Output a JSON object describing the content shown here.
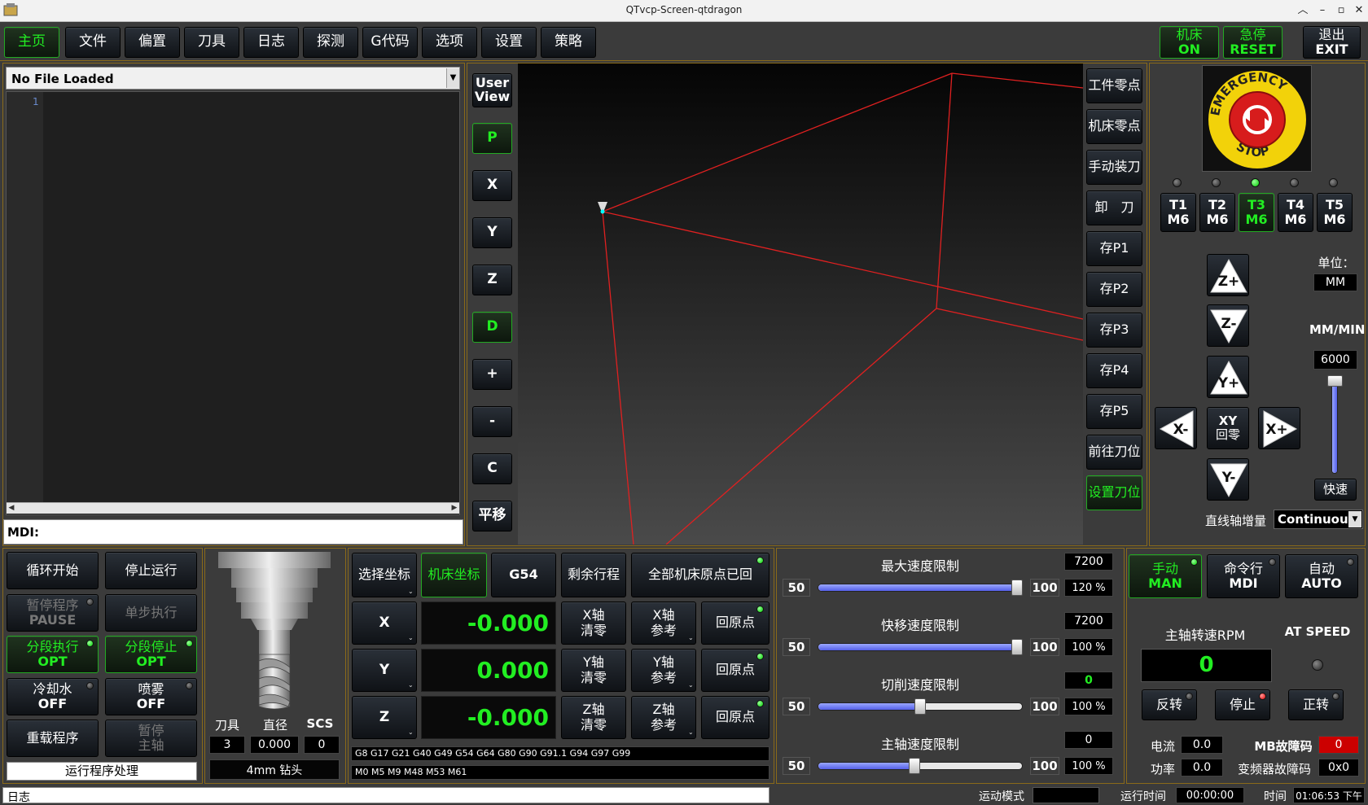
{
  "window": {
    "title": "QTvcp-Screen-qtdragon"
  },
  "tabs": [
    "主页",
    "文件",
    "偏置",
    "刀具",
    "日志",
    "探测",
    "G代码",
    "选项",
    "设置",
    "策略"
  ],
  "machine": {
    "on_top": "机床",
    "on_bottom": "ON",
    "estop_top": "急停",
    "estop_bottom": "RESET",
    "exit_top": "退出",
    "exit_bottom": "EXIT"
  },
  "editor": {
    "file": "No File Loaded",
    "line_number": "1",
    "mdi_label": "MDI:"
  },
  "view_buttons": {
    "user_view": "User View",
    "p": "P",
    "x": "X",
    "y": "Y",
    "z": "Z",
    "d": "D",
    "plus": "+",
    "minus": "-",
    "c": "C",
    "pan": "平移"
  },
  "right_buttons": [
    "工件零点",
    "机床零点",
    "手动装刀",
    "卸　刀",
    "存P1",
    "存P2",
    "存P3",
    "存P4",
    "存P5",
    "前往刀位",
    "设置刀位"
  ],
  "estop_image": {
    "text": "EMERGENCY STOP"
  },
  "tool_buttons": [
    {
      "t": "T1",
      "m": "M6"
    },
    {
      "t": "T2",
      "m": "M6"
    },
    {
      "t": "T3",
      "m": "M6"
    },
    {
      "t": "T4",
      "m": "M6"
    },
    {
      "t": "T5",
      "m": "M6"
    }
  ],
  "jog": {
    "zp": "Z+",
    "zm": "Z-",
    "yp": "Y+",
    "ym": "Y-",
    "xp": "X+",
    "xm": "X-",
    "xy_top": "XY",
    "xy_bottom": "回零"
  },
  "units": {
    "label": "单位：",
    "value": "MM",
    "rate_label": "MM/MIN",
    "rate_value": "6000",
    "rapid": "快速",
    "increment_label": "直线轴增量",
    "increment_value": "Continuous",
    "jog_rate_level": 0.95
  },
  "program": {
    "cycle_start": "循环开始",
    "stop": "停止运行",
    "pause_top": "暂停程序",
    "pause_bottom": "PAUSE",
    "step": "单步执行",
    "opt_exec_top": "分段执行",
    "opt_exec_bottom": "OPT",
    "opt_stop_top": "分段停止",
    "opt_stop_bottom": "OPT",
    "coolant_top": "冷却水",
    "coolant_bottom": "OFF",
    "mist_top": "喷雾",
    "mist_bottom": "OFF",
    "reload": "重载程序",
    "pause2_top": "暂停",
    "pause2_bottom": "主轴",
    "status": "运行程序处理"
  },
  "tool_info": {
    "tool_label": "刀具",
    "dia_label": "直径",
    "scs_label": "SCS",
    "tool": "3",
    "dia": "0.000",
    "scs": "0",
    "name": "4mm 钻头"
  },
  "dro": {
    "select_coord": "选择坐标",
    "machine_coord": "机床坐标",
    "g54": "G54",
    "dtg": "剩余行程",
    "all_homed": "全部机床原点已回",
    "axes": [
      {
        "axis": "X",
        "value": "-0.000",
        "zero_top": "X轴",
        "zero_bottom": "清零",
        "ref_top": "X轴",
        "ref_bottom": "参考",
        "home": "回原点"
      },
      {
        "axis": "Y",
        "value": "0.000",
        "zero_top": "Y轴",
        "zero_bottom": "清零",
        "ref_top": "Y轴",
        "ref_bottom": "参考",
        "home": "回原点"
      },
      {
        "axis": "Z",
        "value": "-0.000",
        "zero_top": "Z轴",
        "zero_bottom": "清零",
        "ref_top": "Z轴",
        "ref_bottom": "参考",
        "home": "回原点"
      }
    ],
    "gcodes": "G8 G17 G21 G40 G49 G54 G64 G80 G90 G91.1 G94 G97 G99",
    "mcodes": "M0 M5 M9 M48 M53 M61"
  },
  "overrides": [
    {
      "title": "最大速度限制",
      "value": "7200",
      "min": "50",
      "max": "100",
      "pct": "120 %",
      "level": 1.0
    },
    {
      "title": "快移速度限制",
      "value": "7200",
      "min": "50",
      "max": "100",
      "pct": "100 %",
      "level": 1.0
    },
    {
      "title": "切削速度限制",
      "value": "0",
      "min": "50",
      "max": "100",
      "pct": "100 %",
      "level": 0.5
    },
    {
      "title": "主轴速度限制",
      "value": "0",
      "min": "50",
      "max": "100",
      "pct": "100 %",
      "level": 0.47
    }
  ],
  "modes": {
    "man_top": "手动",
    "man_bottom": "MAN",
    "mdi_top": "命令行",
    "mdi_bottom": "MDI",
    "auto_top": "自动",
    "auto_bottom": "AUTO"
  },
  "spindle": {
    "rpm_label": "主轴转速RPM",
    "at_speed": "AT SPEED",
    "rpm": "0",
    "rev": "反转",
    "stop": "停止",
    "fwd": "正转",
    "current_label": "电流",
    "current": "0.0",
    "power_label": "功率",
    "power": "0.0",
    "mb_fault_label": "MB故障码",
    "mb_fault": "0",
    "vfd_fault_label": "变频器故障码",
    "vfd_fault": "0x0"
  },
  "statusbar": {
    "log": "日志",
    "motion_mode": "运动模式",
    "run_time_label": "运行时间",
    "run_time": "00:00:00",
    "time_label": "时间",
    "time": "01:06:53 下午"
  },
  "colors": {
    "accent": "#22ee22",
    "frame": "#8a6a1a",
    "background": "#3b3b3b",
    "fault": "#cc0000"
  }
}
